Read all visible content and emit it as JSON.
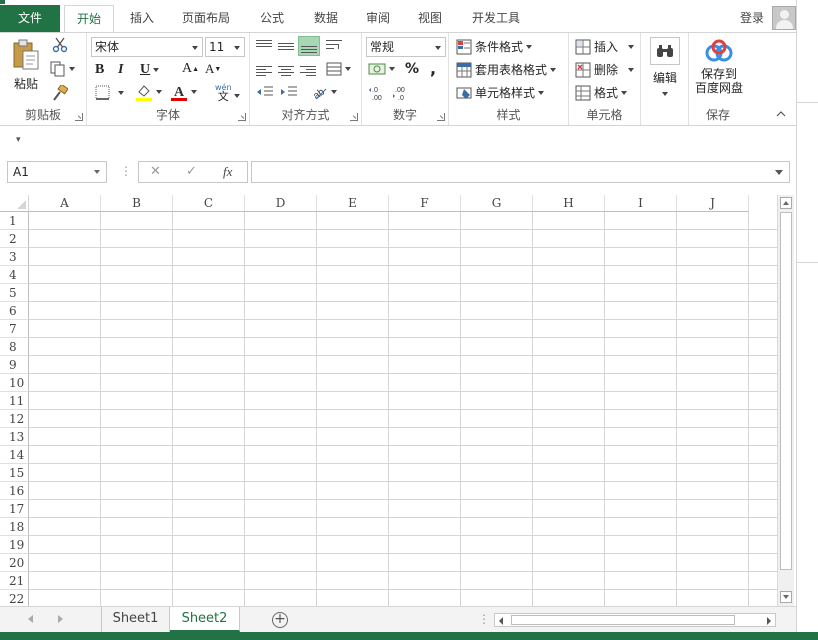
{
  "tabs": {
    "file": "文件",
    "home": "开始",
    "insert": "插入",
    "page_layout": "页面布局",
    "formulas": "公式",
    "data": "数据",
    "review": "审阅",
    "view": "视图",
    "developer": "开发工具"
  },
  "account": {
    "login": "登录"
  },
  "ribbon": {
    "clipboard": {
      "paste": "粘贴",
      "label": "剪贴板"
    },
    "font": {
      "name": "宋体",
      "size": "11",
      "bold": "B",
      "italic": "I",
      "underline": "U",
      "grow": "A",
      "shrink": "A",
      "phonetic": "wén",
      "label": "字体"
    },
    "alignment": {
      "label": "对齐方式"
    },
    "number": {
      "format": "常规",
      "percent": "%",
      "comma": ",",
      "label": "数字"
    },
    "styles": {
      "conditional": "条件格式",
      "table": "套用表格格式",
      "cell_styles": "单元格样式",
      "label": "样式"
    },
    "cells": {
      "insert": "插入",
      "delete": "删除",
      "format": "格式",
      "label": "单元格"
    },
    "editing": {
      "label_btn": "编辑"
    },
    "save": {
      "label_btn_1": "保存到",
      "label_btn_2": "百度网盘",
      "label": "保存"
    }
  },
  "formula_bar": {
    "name_box": "A1",
    "fx": "fx",
    "cancel": "✕",
    "enter": "✓",
    "value": ""
  },
  "grid": {
    "columns": [
      "A",
      "B",
      "C",
      "D",
      "E",
      "F",
      "G",
      "H",
      "I",
      "J"
    ],
    "rows": [
      "1",
      "2",
      "3",
      "4",
      "5",
      "6",
      "7",
      "8",
      "9",
      "10",
      "11",
      "12",
      "13",
      "14",
      "15",
      "16",
      "17",
      "18",
      "19",
      "20",
      "21",
      "22"
    ]
  },
  "sheets": {
    "items": [
      "Sheet1",
      "Sheet2"
    ],
    "active": "Sheet2"
  },
  "colors": {
    "accent": "#217346",
    "grid": "#d4d4d4"
  }
}
